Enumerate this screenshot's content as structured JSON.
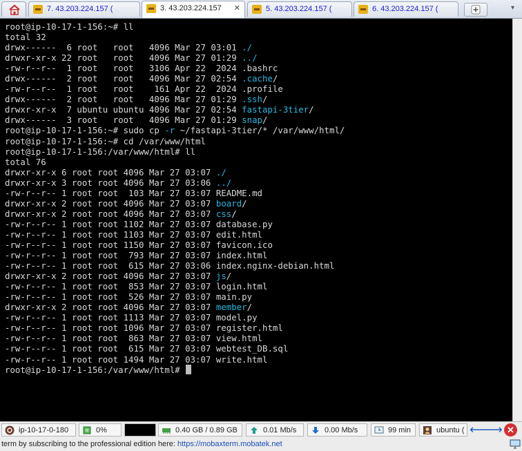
{
  "tabs": [
    {
      "label": "7. 43.203.224.157 (",
      "active": false
    },
    {
      "label": "3. 43.203.224.157",
      "active": true
    },
    {
      "label": "5. 43.203.224.157 (",
      "active": false
    },
    {
      "label": "6. 43.203.224.157 (",
      "active": false
    }
  ],
  "tab_close_glyph": "✕",
  "terminal": {
    "lines": [
      {
        "segments": [
          {
            "t": "root@ip-10-17-1-156:~# ll"
          }
        ]
      },
      {
        "segments": [
          {
            "t": "total 32"
          }
        ]
      },
      {
        "segments": [
          {
            "t": "drwx------  6 root   root   4096 Mar 27 03:01 "
          },
          {
            "t": "./",
            "c": "cyan"
          }
        ]
      },
      {
        "segments": [
          {
            "t": "drwxr-xr-x 22 root   root   4096 Mar 27 01:29 "
          },
          {
            "t": "../",
            "c": "cyan"
          }
        ]
      },
      {
        "segments": [
          {
            "t": "-rw-r--r--  1 root   root   3106 Apr 22  2024 .bashrc"
          }
        ]
      },
      {
        "segments": [
          {
            "t": "drwx------  2 root   root   4096 Mar 27 02:54 "
          },
          {
            "t": ".cache",
            "c": "cyan"
          },
          {
            "t": "/"
          }
        ]
      },
      {
        "segments": [
          {
            "t": "-rw-r--r--  1 root   root    161 Apr 22  2024 .profile"
          }
        ]
      },
      {
        "segments": [
          {
            "t": "drwx------  2 root   root   4096 Mar 27 01:29 "
          },
          {
            "t": ".ssh",
            "c": "cyan"
          },
          {
            "t": "/"
          }
        ]
      },
      {
        "segments": [
          {
            "t": "drwxr-xr-x  7 ubuntu ubuntu 4096 Mar 27 02:54 "
          },
          {
            "t": "fastapi-3tier",
            "c": "cyan"
          },
          {
            "t": "/"
          }
        ]
      },
      {
        "segments": [
          {
            "t": "drwx------  3 root   root   4096 Mar 27 01:29 "
          },
          {
            "t": "snap",
            "c": "cyan"
          },
          {
            "t": "/"
          }
        ]
      },
      {
        "segments": [
          {
            "t": "root@ip-10-17-1-156:~# sudo cp "
          },
          {
            "t": "-r",
            "c": "cyan"
          },
          {
            "t": " ~/fastapi-3tier/* /var/www/html/"
          }
        ]
      },
      {
        "segments": [
          {
            "t": "root@ip-10-17-1-156:~# cd /var/www/html"
          }
        ]
      },
      {
        "segments": [
          {
            "t": "root@ip-10-17-1-156:/var/www/html# ll"
          }
        ]
      },
      {
        "segments": [
          {
            "t": "total 76"
          }
        ]
      },
      {
        "segments": [
          {
            "t": "drwxr-xr-x 6 root root 4096 Mar 27 03:07 "
          },
          {
            "t": "./",
            "c": "cyan"
          }
        ]
      },
      {
        "segments": [
          {
            "t": "drwxr-xr-x 3 root root 4096 Mar 27 03:06 "
          },
          {
            "t": "../",
            "c": "cyan"
          }
        ]
      },
      {
        "segments": [
          {
            "t": "-rw-r--r-- 1 root root  103 Mar 27 03:07 README.md"
          }
        ]
      },
      {
        "segments": [
          {
            "t": "drwxr-xr-x 2 root root 4096 Mar 27 03:07 "
          },
          {
            "t": "board",
            "c": "cyan"
          },
          {
            "t": "/"
          }
        ]
      },
      {
        "segments": [
          {
            "t": "drwxr-xr-x 2 root root 4096 Mar 27 03:07 "
          },
          {
            "t": "css",
            "c": "cyan"
          },
          {
            "t": "/"
          }
        ]
      },
      {
        "segments": [
          {
            "t": "-rw-r--r-- 1 root root 1102 Mar 27 03:07 database.py"
          }
        ]
      },
      {
        "segments": [
          {
            "t": "-rw-r--r-- 1 root root 1103 Mar 27 03:07 edit.html"
          }
        ]
      },
      {
        "segments": [
          {
            "t": "-rw-r--r-- 1 root root 1150 Mar 27 03:07 favicon.ico"
          }
        ]
      },
      {
        "segments": [
          {
            "t": "-rw-r--r-- 1 root root  793 Mar 27 03:07 index.html"
          }
        ]
      },
      {
        "segments": [
          {
            "t": "-rw-r--r-- 1 root root  615 Mar 27 03:06 index.nginx-debian.html"
          }
        ]
      },
      {
        "segments": [
          {
            "t": "drwxr-xr-x 2 root root 4096 Mar 27 03:07 "
          },
          {
            "t": "js",
            "c": "cyan"
          },
          {
            "t": "/"
          }
        ]
      },
      {
        "segments": [
          {
            "t": "-rw-r--r-- 1 root root  853 Mar 27 03:07 login.html"
          }
        ]
      },
      {
        "segments": [
          {
            "t": "-rw-r--r-- 1 root root  526 Mar 27 03:07 main.py"
          }
        ]
      },
      {
        "segments": [
          {
            "t": "drwxr-xr-x 2 root root 4096 Mar 27 03:07 "
          },
          {
            "t": "member",
            "c": "cyan"
          },
          {
            "t": "/"
          }
        ]
      },
      {
        "segments": [
          {
            "t": "-rw-r--r-- 1 root root 1113 Mar 27 03:07 model.py"
          }
        ]
      },
      {
        "segments": [
          {
            "t": "-rw-r--r-- 1 root root 1096 Mar 27 03:07 register.html"
          }
        ]
      },
      {
        "segments": [
          {
            "t": "-rw-r--r-- 1 root root  863 Mar 27 03:07 view.html"
          }
        ]
      },
      {
        "segments": [
          {
            "t": "-rw-r--r-- 1 root root  615 Mar 27 03:07 webtest_DB.sql"
          }
        ]
      },
      {
        "segments": [
          {
            "t": "-rw-r--r-- 1 root root 1494 Mar 27 03:07 write.html"
          }
        ]
      },
      {
        "segments": [
          {
            "t": "root@ip-10-17-1-156:/var/www/html# "
          }
        ],
        "cursor": true
      }
    ]
  },
  "statusbar": {
    "hostname": "ip-10-17-0-180",
    "cpu": "0%",
    "memory": "0.40 GB / 0.89 GB",
    "upload": "0.01 Mb/s",
    "download": "0.00 Mb/s",
    "uptime": "99 min",
    "user": "ubuntu ("
  },
  "footer": {
    "message": "term by subscribing to the professional edition here:",
    "link": "https://mobaxterm.mobatek.net"
  },
  "colors": {
    "terminal_bg": "#000000",
    "terminal_fg": "#d8d8d8",
    "directory": "#2ab8e0",
    "tab_text": "#1b1bd1",
    "link": "#1a4fb5"
  }
}
